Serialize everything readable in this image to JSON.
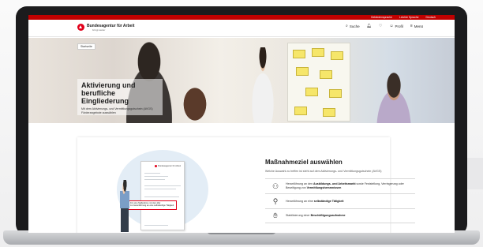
{
  "topbar": {
    "items": [
      "Gebärdensprache",
      "Leichte Sprache",
      "Deutsch"
    ]
  },
  "header": {
    "logo_name": "Bundesagentur für Arbeit",
    "logo_sub": "bringt weiter",
    "nav": [
      {
        "label": "Suche",
        "icon": "search-icon"
      },
      {
        "label": "",
        "icon": "bell-icon"
      },
      {
        "label": "",
        "icon": "heart-icon"
      },
      {
        "label": "Profil",
        "icon": "user-icon"
      },
      {
        "label": "Menü",
        "icon": "menu-icon"
      }
    ]
  },
  "hero": {
    "breadcrumb": "Startseite",
    "title": "Aktivierung und berufliche Eingliederung",
    "subtitle": "Mit dem Aktivierungs- und Vermittlungsgutschein (AVGS) Förderangebote auswählen"
  },
  "illustration": {
    "doc_logo": "Bundesagentur für Arbeit",
    "callout_line1": "Für eine Maßnahme mit dem Ziel",
    "callout_line2": "zur Heranführung an eine selbständige Tätigkeit"
  },
  "panel": {
    "title": "Maßnahmeziel auswählen",
    "subtitle": "Welche Auswahl zu treffen ist steht auf dem Aktivierungs- und Vermittlungsgutschein (AVGS)",
    "options": [
      {
        "icon": "people-icon",
        "pre": "Heranführung an den ",
        "bold": "Ausbildungs- und Arbeitsmarkt",
        "post": " sowie Feststellung, Verringerung oder Beseitigung von ",
        "bold2": "Vermittlungshemmnissen"
      },
      {
        "icon": "person-arrow-icon",
        "pre": "Heranführung an eine ",
        "bold": "selbständige Tätigkeit",
        "post": "",
        "bold2": ""
      },
      {
        "icon": "handshake-icon",
        "pre": "Stabilisierung einer ",
        "bold": "Beschäftigungsaufnahme",
        "post": "",
        "bold2": ""
      }
    ]
  }
}
